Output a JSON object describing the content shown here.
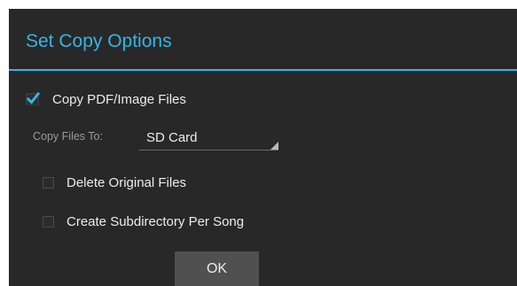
{
  "dialog": {
    "title": "Set Copy Options",
    "accent_color": "#33b5e5",
    "background_color": "#282828"
  },
  "options": {
    "copy_files": {
      "label": "Copy PDF/Image Files",
      "checked": true
    },
    "copy_to": {
      "label": "Copy Files To:",
      "selected": "SD Card"
    },
    "delete_original": {
      "label": "Delete Original Files",
      "checked": false
    },
    "create_subdirectory": {
      "label": "Create Subdirectory Per Song",
      "checked": false
    }
  },
  "buttons": {
    "ok_label": "OK"
  },
  "icons": {
    "checkmark": "check-icon",
    "spinner": "dropdown-triangle-icon"
  }
}
